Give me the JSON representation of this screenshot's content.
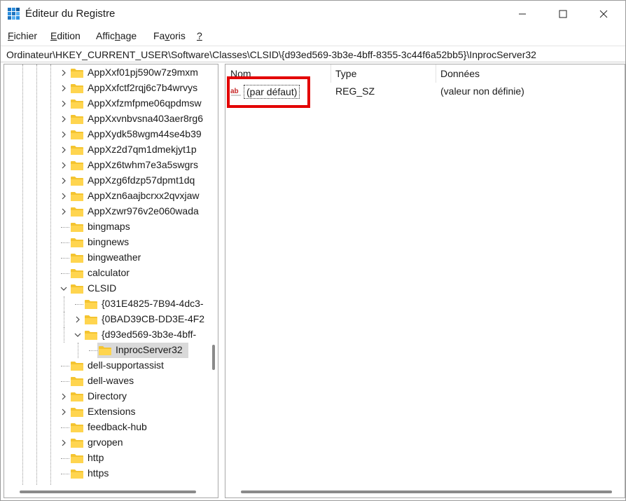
{
  "window": {
    "title": "Éditeur du Registre"
  },
  "menu": {
    "items": [
      {
        "first": "F",
        "rest": "ichier"
      },
      {
        "first": "E",
        "rest": "dition"
      },
      {
        "pre": "Affic",
        "first": "h",
        "rest": "age"
      },
      {
        "pre": "Fa",
        "first": "v",
        "rest": "oris"
      },
      {
        "first": "?",
        "rest": ""
      }
    ]
  },
  "address": {
    "path": "Ordinateur\\HKEY_CURRENT_USER\\Software\\Classes\\CLSID\\{d93ed569-3b3e-4bff-8355-3c44f6a52bb5}\\InprocServer32"
  },
  "tree": {
    "items": [
      {
        "label": "AppXxf01pj590w7z9mxm",
        "expandable": true
      },
      {
        "label": "AppXxfctf2rqj6c7b4wrvys",
        "expandable": true
      },
      {
        "label": "AppXxfzmfpme06qpdmsw",
        "expandable": true
      },
      {
        "label": "AppXxvnbvsna403aer8rg6",
        "expandable": true
      },
      {
        "label": "AppXydk58wgm44se4b39",
        "expandable": true
      },
      {
        "label": "AppXz2d7qm1dmekjyt1p",
        "expandable": true
      },
      {
        "label": "AppXz6twhm7e3a5swgrs",
        "expandable": true
      },
      {
        "label": "AppXzg6fdzp57dpmt1dq",
        "expandable": true
      },
      {
        "label": "AppXzn6aajbcrxx2qvxjaw",
        "expandable": true
      },
      {
        "label": "AppXzwr976v2e060wada",
        "expandable": true
      },
      {
        "label": "bingmaps",
        "expandable": false
      },
      {
        "label": "bingnews",
        "expandable": false
      },
      {
        "label": "bingweather",
        "expandable": false
      },
      {
        "label": "calculator",
        "expandable": false
      },
      {
        "label": "CLSID",
        "expandable": true,
        "expanded": true
      },
      {
        "label": "{031E4825-7B94-4dc3-",
        "expandable": false,
        "depth": 1
      },
      {
        "label": "{0BAD39CB-DD3E-4F2",
        "expandable": true,
        "depth": 1
      },
      {
        "label": "{d93ed569-3b3e-4bff-",
        "expandable": true,
        "expanded": true,
        "depth": 1
      },
      {
        "label": "InprocServer32",
        "expandable": false,
        "depth": 2,
        "selected": true
      },
      {
        "label": "dell-supportassist",
        "expandable": false
      },
      {
        "label": "dell-waves",
        "expandable": false
      },
      {
        "label": "Directory",
        "expandable": true
      },
      {
        "label": "Extensions",
        "expandable": true
      },
      {
        "label": "feedback-hub",
        "expandable": false
      },
      {
        "label": "grvopen",
        "expandable": true
      },
      {
        "label": "http",
        "expandable": false
      },
      {
        "label": "https",
        "expandable": false
      }
    ]
  },
  "values": {
    "columns": {
      "name": "Nom",
      "type": "Type",
      "data": "Données"
    },
    "rows": [
      {
        "name": "(par défaut)",
        "type": "REG_SZ",
        "data": "(valeur non définie)"
      }
    ]
  },
  "colors": {
    "highlight": "#e30000",
    "folder": "#f4c430",
    "selection": "#d9d9d9"
  }
}
